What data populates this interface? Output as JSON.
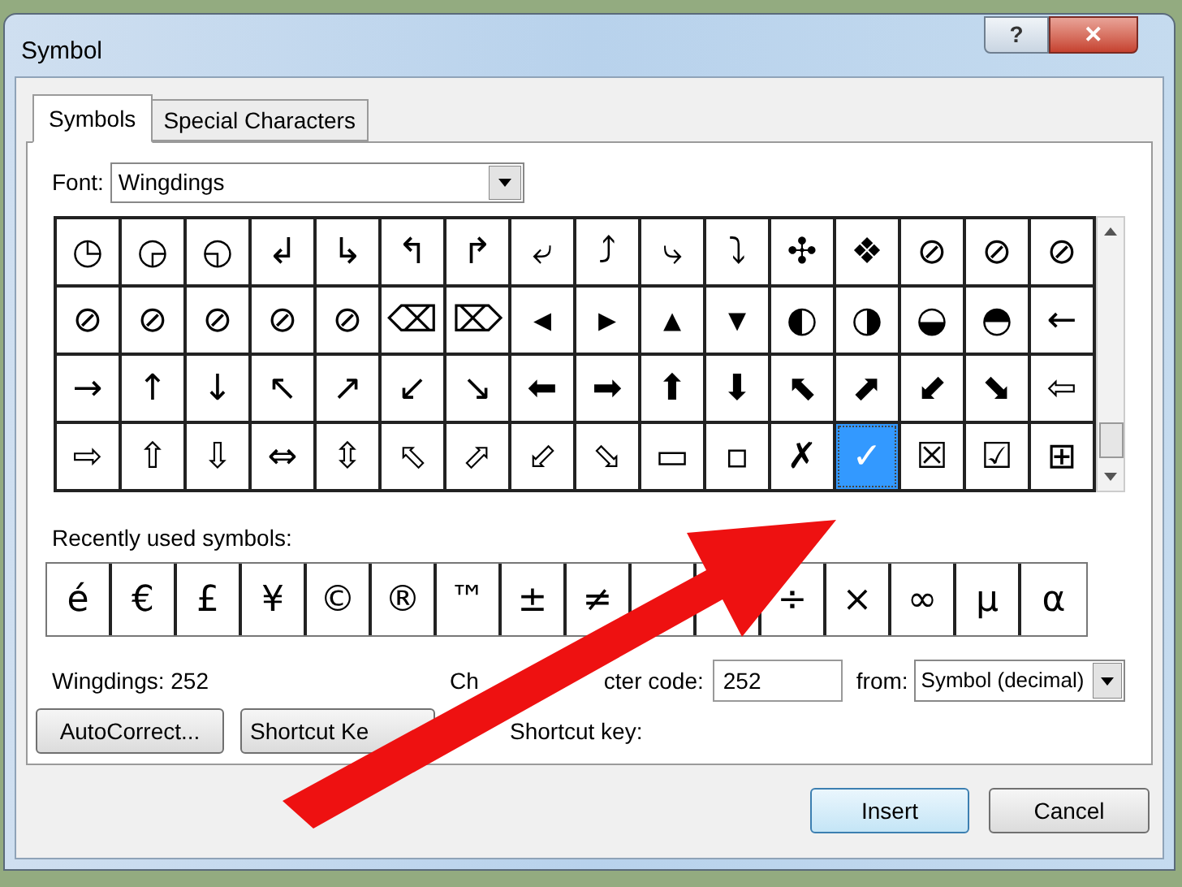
{
  "window": {
    "title": "Symbol",
    "help_button": "?",
    "close_button": "✕"
  },
  "tabs": [
    {
      "label": "Symbols",
      "selected": true
    },
    {
      "label": "Special Characters",
      "selected": false
    }
  ],
  "font": {
    "label": "Font:",
    "value": "Wingdings"
  },
  "symbols": [
    {
      "char": "◷",
      "selected": false
    },
    {
      "char": "◶",
      "selected": false
    },
    {
      "char": "◵",
      "selected": false
    },
    {
      "char": "↲",
      "selected": false
    },
    {
      "char": "↳",
      "selected": false
    },
    {
      "char": "↰",
      "selected": false
    },
    {
      "char": "↱",
      "selected": false
    },
    {
      "char": "⤶",
      "selected": false
    },
    {
      "char": "⤴",
      "selected": false
    },
    {
      "char": "⤷",
      "selected": false
    },
    {
      "char": "⤵",
      "selected": false
    },
    {
      "char": "✣",
      "selected": false
    },
    {
      "char": "❖",
      "selected": false
    },
    {
      "char": "⊘",
      "selected": false
    },
    {
      "char": "⊘",
      "selected": false
    },
    {
      "char": "⊘",
      "selected": false
    },
    {
      "char": "⊘",
      "selected": false
    },
    {
      "char": "⊘",
      "selected": false
    },
    {
      "char": "⊘",
      "selected": false
    },
    {
      "char": "⊘",
      "selected": false
    },
    {
      "char": "⊘",
      "selected": false
    },
    {
      "char": "⌫",
      "selected": false
    },
    {
      "char": "⌦",
      "selected": false
    },
    {
      "char": "◂",
      "selected": false
    },
    {
      "char": "▸",
      "selected": false
    },
    {
      "char": "▴",
      "selected": false
    },
    {
      "char": "▾",
      "selected": false
    },
    {
      "char": "◐",
      "selected": false
    },
    {
      "char": "◑",
      "selected": false
    },
    {
      "char": "◒",
      "selected": false
    },
    {
      "char": "◓",
      "selected": false
    },
    {
      "char": "←",
      "selected": false
    },
    {
      "char": "→",
      "selected": false
    },
    {
      "char": "↑",
      "selected": false
    },
    {
      "char": "↓",
      "selected": false
    },
    {
      "char": "↖",
      "selected": false
    },
    {
      "char": "↗",
      "selected": false
    },
    {
      "char": "↙",
      "selected": false
    },
    {
      "char": "↘",
      "selected": false
    },
    {
      "char": "⬅",
      "selected": false
    },
    {
      "char": "➡",
      "selected": false
    },
    {
      "char": "⬆",
      "selected": false
    },
    {
      "char": "⬇",
      "selected": false
    },
    {
      "char": "⬉",
      "selected": false
    },
    {
      "char": "⬈",
      "selected": false
    },
    {
      "char": "⬋",
      "selected": false
    },
    {
      "char": "⬊",
      "selected": false
    },
    {
      "char": "⇦",
      "selected": false
    },
    {
      "char": "⇨",
      "selected": false
    },
    {
      "char": "⇧",
      "selected": false
    },
    {
      "char": "⇩",
      "selected": false
    },
    {
      "char": "⇔",
      "selected": false
    },
    {
      "char": "⇳",
      "selected": false
    },
    {
      "char": "⬁",
      "selected": false
    },
    {
      "char": "⬀",
      "selected": false
    },
    {
      "char": "⬃",
      "selected": false
    },
    {
      "char": "⬂",
      "selected": false
    },
    {
      "char": "▭",
      "selected": false
    },
    {
      "char": "▫",
      "selected": false
    },
    {
      "char": "✗",
      "selected": false
    },
    {
      "char": "✓",
      "selected": true
    },
    {
      "char": "☒",
      "selected": false
    },
    {
      "char": "☑",
      "selected": false
    },
    {
      "char": "⊞",
      "selected": false
    }
  ],
  "recent": {
    "label": "Recently used symbols:",
    "symbols": [
      {
        "kind": "symbol",
        "char": "é"
      },
      {
        "kind": "symbol",
        "char": "€"
      },
      {
        "kind": "symbol",
        "char": "£"
      },
      {
        "kind": "symbol",
        "char": "¥"
      },
      {
        "kind": "symbol",
        "char": "©"
      },
      {
        "kind": "symbol",
        "char": "®"
      },
      {
        "kind": "symbol",
        "char": "™"
      },
      {
        "kind": "symbol",
        "char": "±"
      },
      {
        "kind": "symbol",
        "char": "≠"
      },
      {
        "kind": "covered"
      },
      {
        "kind": "covered"
      },
      {
        "kind": "symbol",
        "char": "÷"
      },
      {
        "kind": "symbol",
        "char": "×"
      },
      {
        "kind": "symbol",
        "char": "∞"
      },
      {
        "kind": "symbol",
        "char": "µ"
      },
      {
        "kind": "symbol",
        "char": "α"
      }
    ]
  },
  "info": {
    "font_code": "Wingdings: 252",
    "character_code_label_parts": [
      "Ch",
      "cter code:"
    ],
    "character_code": "252",
    "from_label": "from:",
    "from_value": "Symbol (decimal)"
  },
  "buttons": {
    "autocorrect": "AutoCorrect...",
    "shortcut_key": "Shortcut Ke",
    "shortcut_key_label": "Shortcut key:",
    "insert": "Insert",
    "cancel": "Cancel"
  }
}
